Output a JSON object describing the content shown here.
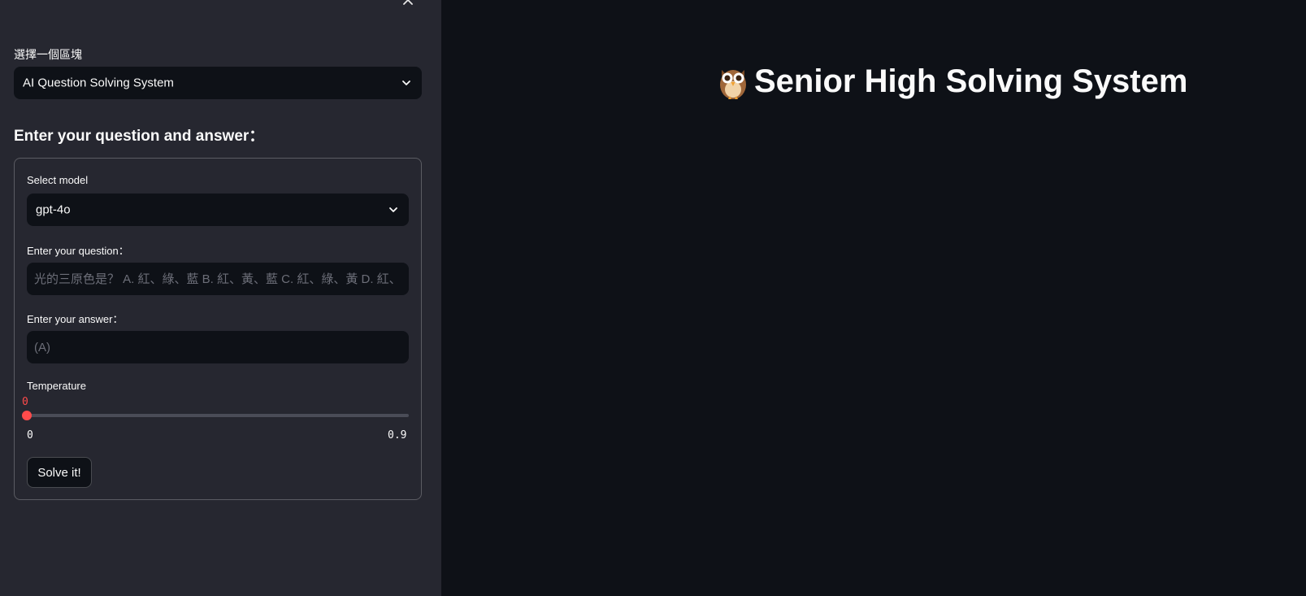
{
  "sidebar": {
    "close_icon": "close-icon",
    "region_label": "選擇一個區塊",
    "region_select_value": "AI Question Solving System",
    "section_heading": "Enter your question and answer：",
    "form": {
      "model_label": "Select model",
      "model_value": "gpt-4o",
      "question_label": "Enter your question：",
      "question_placeholder": "光的三原色是？ A. 紅、綠、藍 B. 紅、黃、藍 C. 紅、綠、黃 D. 紅、",
      "answer_label": "Enter your answer：",
      "answer_placeholder": "(A)",
      "temperature": {
        "label": "Temperature",
        "value": "0",
        "min": "0",
        "max": "0.9",
        "fraction": 0
      },
      "submit_label": "Solve it!"
    }
  },
  "main": {
    "title_icon": "owl-icon",
    "title": "Senior High Solving System"
  },
  "colors": {
    "sidebar_bg": "#262730",
    "main_bg": "#0e1117",
    "accent": "#ff4b4b",
    "text": "#fafafa"
  }
}
